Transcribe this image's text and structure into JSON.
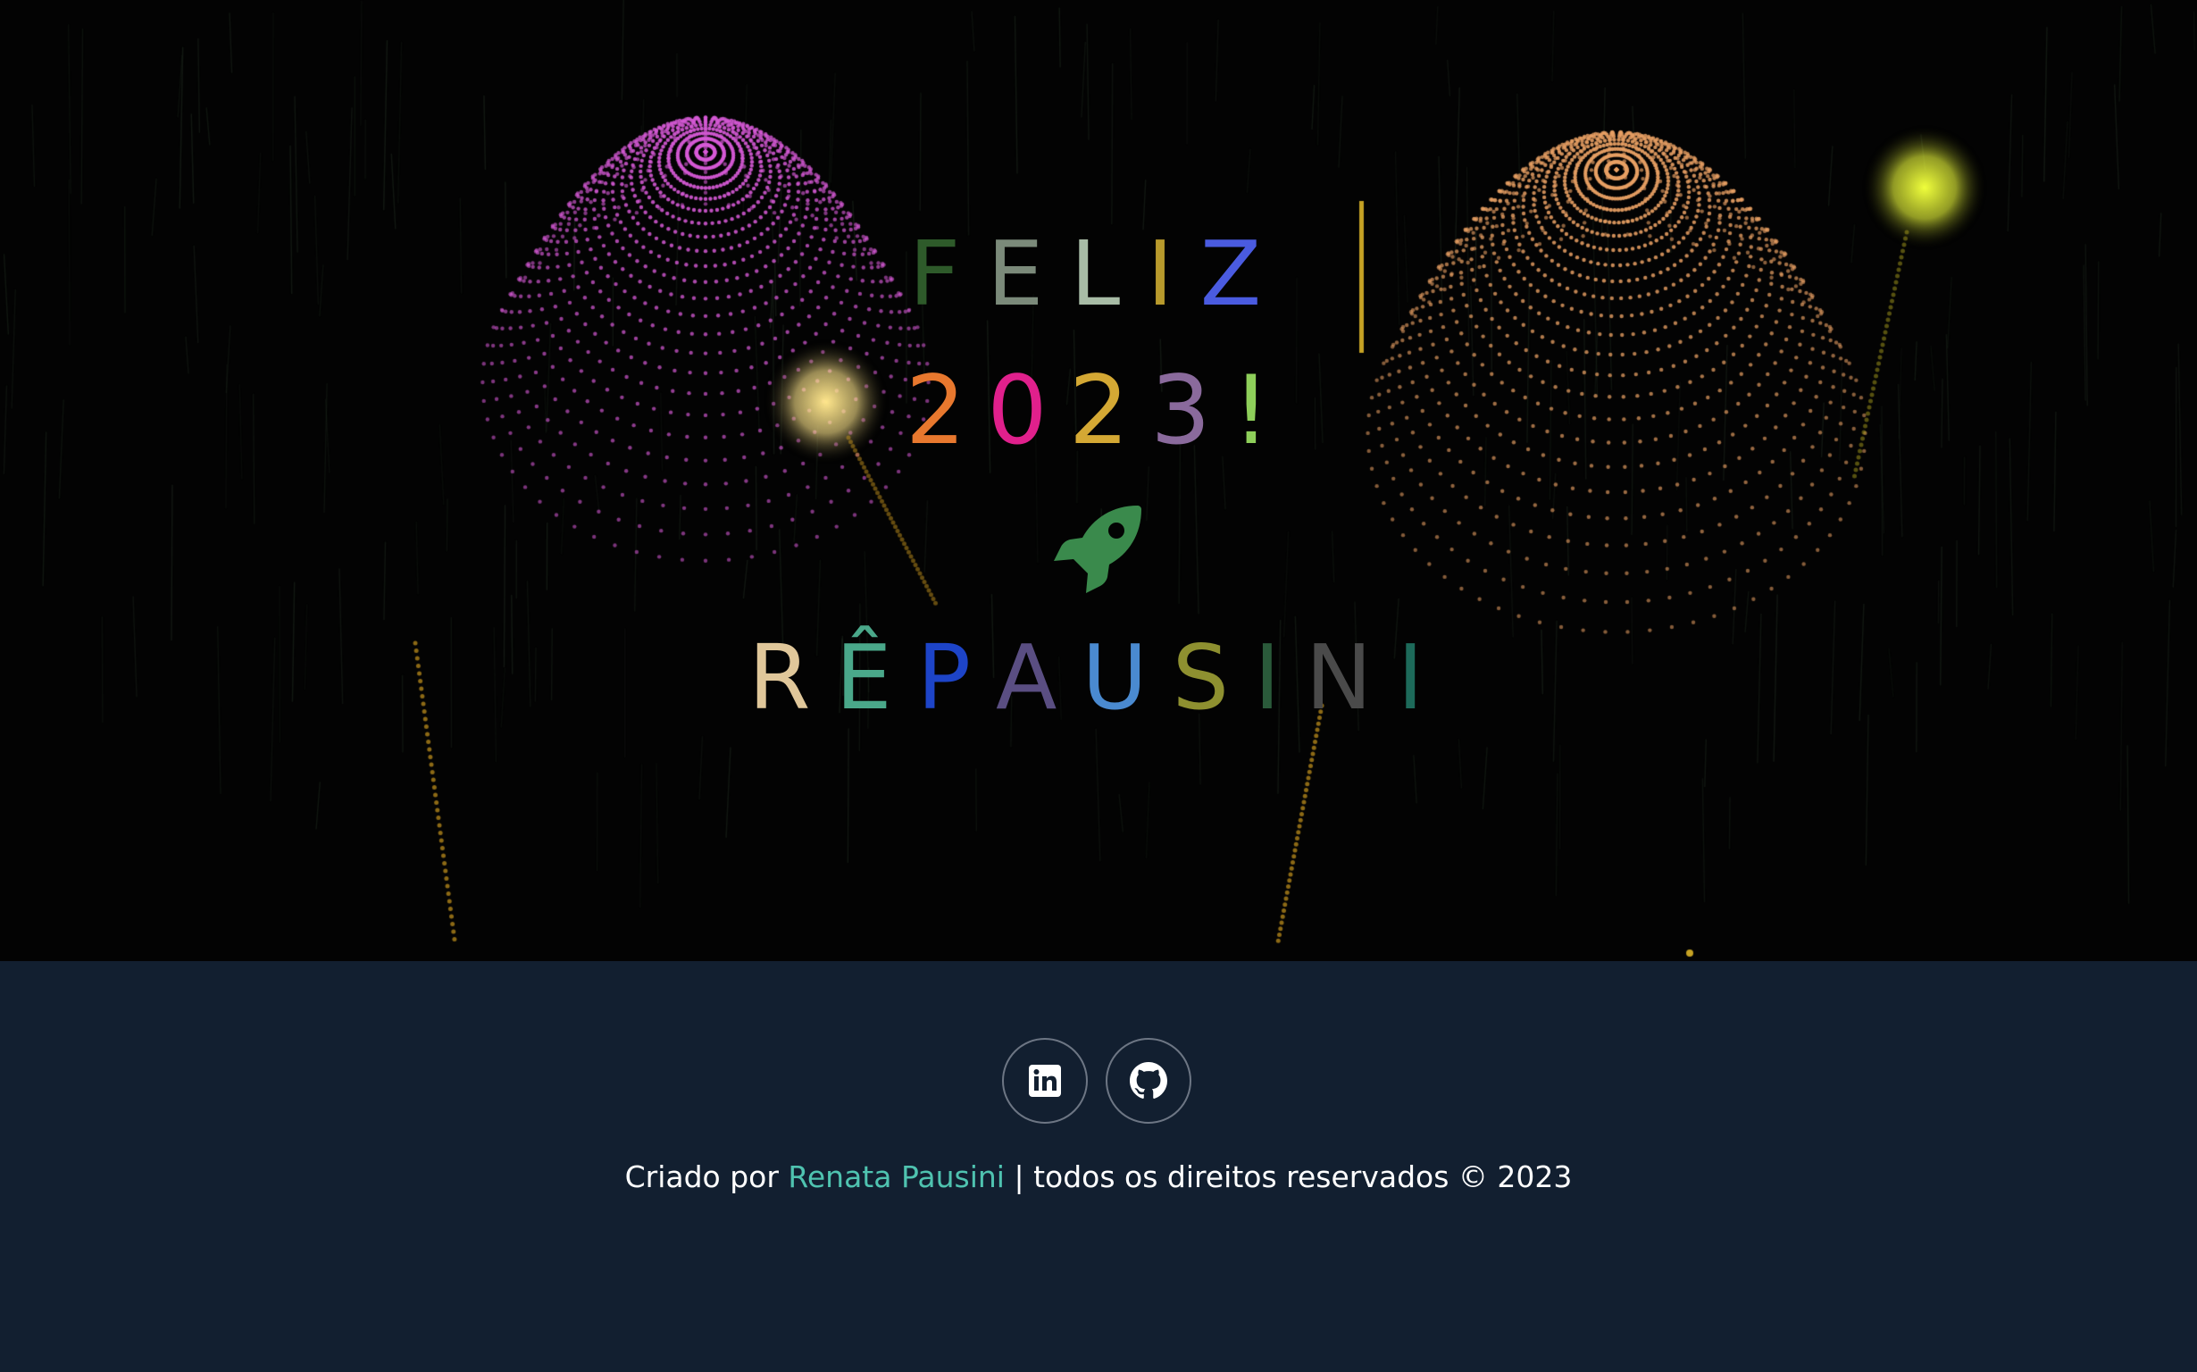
{
  "hero": {
    "line1": {
      "letters": [
        {
          "char": "F",
          "color": "#2e5a2a"
        },
        {
          "char": "E",
          "color": "#7b8a7a"
        },
        {
          "char": "L",
          "color": "#a8bca6"
        },
        {
          "char": "I",
          "color": "#b89a2c"
        },
        {
          "char": "Z",
          "color": "#4a5be0"
        }
      ]
    },
    "line2": {
      "letters": [
        {
          "char": "2",
          "color": "#e8782e"
        },
        {
          "char": "0",
          "color": "#e0208c"
        },
        {
          "char": "2",
          "color": "#d4a834"
        },
        {
          "char": "3",
          "color": "#8a6a9c"
        },
        {
          "char": "!",
          "color": "#8ecf5a"
        }
      ]
    },
    "rocket_icon": {
      "name": "rocket-icon",
      "color": "#3a8a4c"
    },
    "line3": {
      "letters": [
        {
          "char": "R",
          "color": "#e0c79a"
        },
        {
          "char": "Ê",
          "color": "#4aa88a"
        },
        {
          "char": "P",
          "color": "#1d44c8"
        },
        {
          "char": "A",
          "color": "#5a4e82"
        },
        {
          "char": "U",
          "color": "#4a8ad0"
        },
        {
          "char": "S",
          "color": "#8e9030"
        },
        {
          "char": "I",
          "color": "#2a5a3a"
        },
        {
          "char": "N",
          "color": "#4a4a4a"
        },
        {
          "char": "I",
          "color": "#1d6a5a"
        }
      ]
    }
  },
  "footer": {
    "social": [
      {
        "name": "linkedin-icon",
        "label": "LinkedIn"
      },
      {
        "name": "github-icon",
        "label": "GitHub"
      }
    ],
    "credits_prefix": "Criado por ",
    "author_name": "Renata Pausini",
    "credits_suffix": " | todos os direitos reservados © 2023",
    "author_color": "#4fc3b0"
  },
  "colors": {
    "hero_background": "#030303",
    "footer_background": "#121f30"
  }
}
